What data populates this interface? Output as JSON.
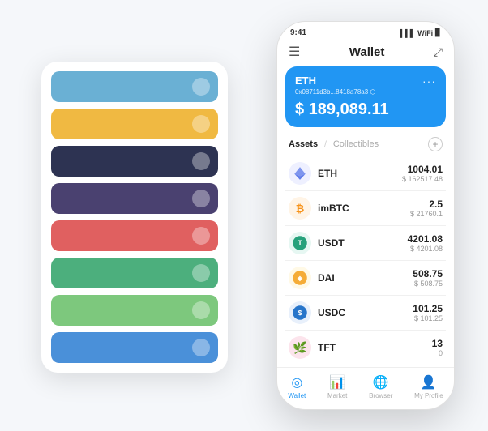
{
  "scene": {
    "card_stack": {
      "items": [
        {
          "color": "#6ab0d4",
          "dot_color": "rgba(255,255,255,0.4)"
        },
        {
          "color": "#f0b942",
          "dot_color": "rgba(255,255,255,0.4)"
        },
        {
          "color": "#2d3352",
          "dot_color": "rgba(255,255,255,0.4)"
        },
        {
          "color": "#4a4170",
          "dot_color": "rgba(255,255,255,0.4)"
        },
        {
          "color": "#e06060",
          "dot_color": "rgba(255,255,255,0.4)"
        },
        {
          "color": "#4caf7d",
          "dot_color": "rgba(255,255,255,0.4)"
        },
        {
          "color": "#7dc87d",
          "dot_color": "rgba(255,255,255,0.4)"
        },
        {
          "color": "#4a90d9",
          "dot_color": "rgba(255,255,255,0.4)"
        }
      ]
    }
  },
  "phone": {
    "status_bar": {
      "time": "9:41",
      "signal": "▌▌▌",
      "wifi": "WiFi",
      "battery": "🔋"
    },
    "header": {
      "menu_icon": "☰",
      "title": "Wallet",
      "expand_icon": "⤢"
    },
    "eth_card": {
      "title": "ETH",
      "address": "0x08711d3b...8418a78a3 ⬡",
      "balance": "$ 189,089.11",
      "more_icon": "···"
    },
    "assets_section": {
      "tab_active": "Assets",
      "divider": "/",
      "tab_inactive": "Collectibles",
      "add_icon": "+"
    },
    "assets": [
      {
        "name": "ETH",
        "amount": "1004.01",
        "usd": "$ 162517.48",
        "icon": "⬡",
        "icon_color": "#627eea",
        "bg_color": "#eef0ff"
      },
      {
        "name": "imBTC",
        "amount": "2.5",
        "usd": "$ 21760.1",
        "icon": "₿",
        "icon_color": "#f7931a",
        "bg_color": "#fff4e6"
      },
      {
        "name": "USDT",
        "amount": "4201.08",
        "usd": "$ 4201.08",
        "icon": "T",
        "icon_color": "#26a17b",
        "bg_color": "#e6f7f2"
      },
      {
        "name": "DAI",
        "amount": "508.75",
        "usd": "$ 508.75",
        "icon": "◈",
        "icon_color": "#f5ac37",
        "bg_color": "#fff9e6"
      },
      {
        "name": "USDC",
        "amount": "101.25",
        "usd": "$ 101.25",
        "icon": "$",
        "icon_color": "#2775ca",
        "bg_color": "#e8f0fb"
      },
      {
        "name": "TFT",
        "amount": "13",
        "usd": "0",
        "icon": "🌿",
        "icon_color": "#e44",
        "bg_color": "#fee"
      }
    ],
    "bottom_nav": [
      {
        "label": "Wallet",
        "icon": "◎",
        "active": true
      },
      {
        "label": "Market",
        "icon": "📊",
        "active": false
      },
      {
        "label": "Browser",
        "icon": "🌐",
        "active": false
      },
      {
        "label": "My Profile",
        "icon": "👤",
        "active": false
      }
    ]
  }
}
